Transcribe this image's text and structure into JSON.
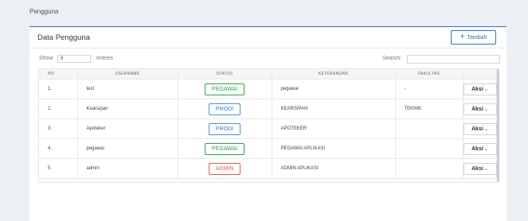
{
  "page": {
    "title": "Pengguna"
  },
  "card": {
    "title": "Data Pengguna",
    "add_button": "Tambah"
  },
  "controls": {
    "show_label": "Show",
    "entries_value": "8",
    "entries_label": "entries",
    "search_label": "Search:"
  },
  "table": {
    "headers": [
      "NO",
      "USERNAME",
      "STATUS",
      "KETERANGAN",
      "FAKULTAS",
      ""
    ],
    "rows": [
      {
        "no": "1.",
        "username": "test",
        "status": "PEGAWAI",
        "keterangan": "pegawai",
        "fakultas": "-",
        "action": "Aksi"
      },
      {
        "no": "2.",
        "username": "Kearsipan",
        "status": "PRODI",
        "keterangan": "KEARSIPAN",
        "fakultas": "TEKNIK",
        "action": "Aksi"
      },
      {
        "no": "3.",
        "username": "Apoteker",
        "status": "PRODI",
        "keterangan": "APOTEKER",
        "fakultas": "",
        "action": "Aksi"
      },
      {
        "no": "4.",
        "username": "pegawai",
        "status": "PEGAWAI",
        "keterangan": "PEGAWAI APLIKASI",
        "fakultas": "",
        "action": "Aksi"
      },
      {
        "no": "5.",
        "username": "admin",
        "status": "ADMIN",
        "keterangan": "ADMIN APLIKASI",
        "fakultas": "",
        "action": "Aksi"
      }
    ]
  },
  "colors": {
    "accent": "#2d6fd6",
    "pegawai": "#28a745",
    "prodi": "#2d7be5",
    "admin": "#ef5b3c"
  },
  "icons": {
    "add": "plus-icon",
    "dropdown": "chevron-down-icon"
  }
}
